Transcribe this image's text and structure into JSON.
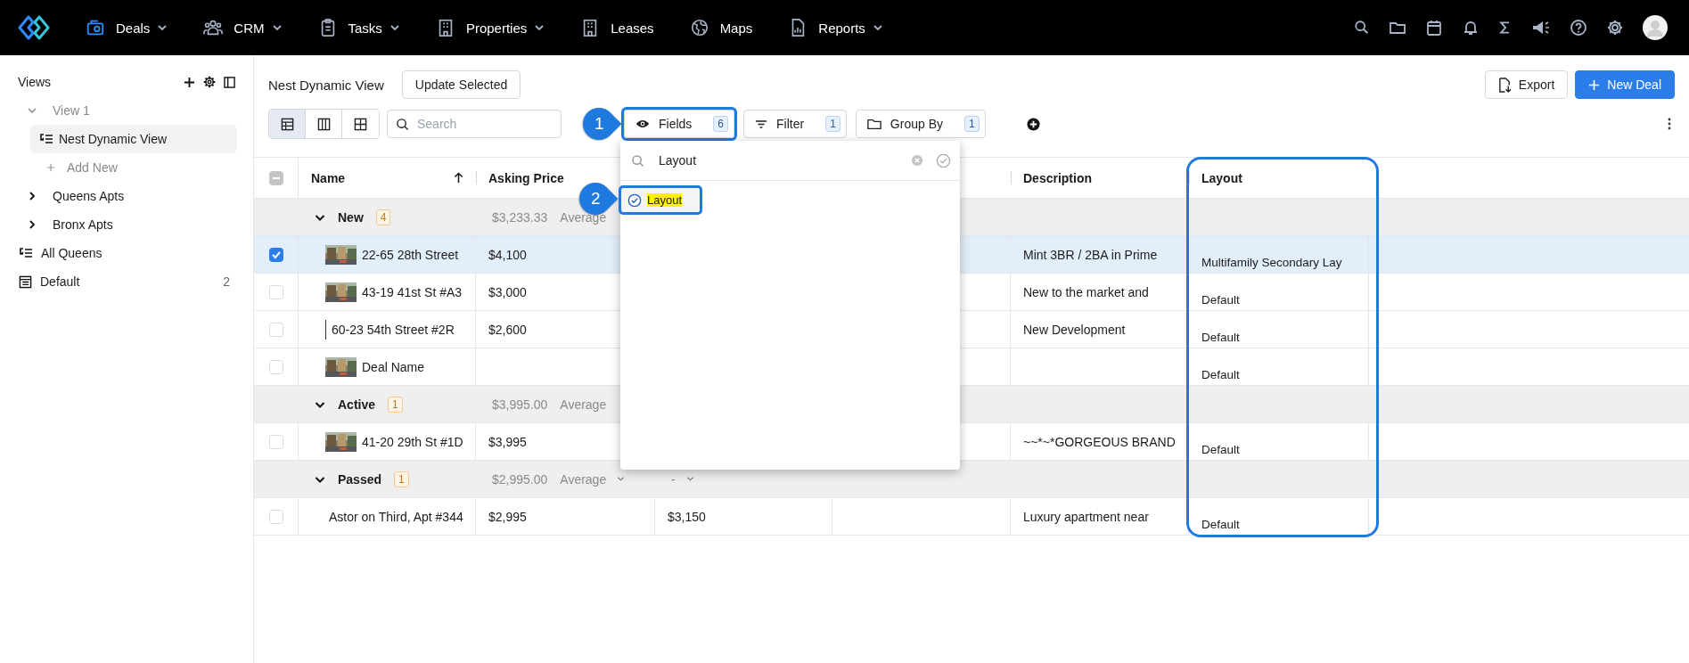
{
  "nav": {
    "items": [
      {
        "label": "Deals",
        "kind": "deals",
        "selected": true,
        "caret": true
      },
      {
        "label": "CRM",
        "kind": "crm",
        "selected": false,
        "caret": true
      },
      {
        "label": "Tasks",
        "kind": "tasks",
        "selected": false,
        "caret": true
      },
      {
        "label": "Properties",
        "kind": "building",
        "selected": false,
        "caret": true
      },
      {
        "label": "Leases",
        "kind": "building",
        "selected": false,
        "caret": false
      },
      {
        "label": "Maps",
        "kind": "globe",
        "selected": false,
        "caret": false
      },
      {
        "label": "Reports",
        "kind": "report",
        "selected": false,
        "caret": true
      }
    ]
  },
  "sidebar": {
    "title": "Views",
    "items": [
      {
        "kind": "folder",
        "label": "View 1",
        "expanded": true,
        "muted": true,
        "selected": false,
        "children": [
          {
            "kind": "view",
            "label": "Nest Dynamic View",
            "selected": true
          },
          {
            "kind": "add",
            "label": "Add New",
            "selected": false
          }
        ]
      },
      {
        "kind": "folder",
        "label": "Queens Apts",
        "expanded": false,
        "muted": false,
        "selected": false
      },
      {
        "kind": "folder",
        "label": "Bronx Apts",
        "expanded": false,
        "muted": false,
        "selected": false
      },
      {
        "kind": "view",
        "label": "All Queens",
        "selected": false
      },
      {
        "kind": "table",
        "label": "Default",
        "count": "2",
        "selected": false
      }
    ]
  },
  "page": {
    "title": "Nest Dynamic View",
    "update_button": "Update Selected",
    "export_button": "Export",
    "new_button": "New Deal"
  },
  "toolbar": {
    "view_modes": [
      {
        "kind": "table",
        "selected": true
      },
      {
        "kind": "columns",
        "selected": false
      },
      {
        "kind": "grid",
        "selected": false
      }
    ],
    "search": {
      "placeholder": "Search"
    },
    "buttons": [
      {
        "kind": "fields",
        "label": "Fields",
        "count": "6",
        "callout": "1"
      },
      {
        "kind": "filter",
        "label": "Filter",
        "count": "1"
      },
      {
        "kind": "group",
        "label": "Group By",
        "count": "1"
      }
    ]
  },
  "fields_menu": {
    "search": {
      "value": "Layout"
    },
    "items": [
      {
        "label": "Layout",
        "checked": true,
        "match": true,
        "callout": "2"
      }
    ]
  },
  "table": {
    "indeterminate": true,
    "columns": [
      {
        "label": "Name",
        "sorted": true
      },
      {
        "label": "Asking Price"
      },
      {},
      {},
      {
        "label": "Description"
      },
      {
        "label": "Layout",
        "outlined": true
      }
    ],
    "groups": [
      {
        "label": "New",
        "count": "4",
        "expanded": true,
        "summaries": [
          {
            "value": "$3,233.33",
            "label": "Average",
            "menu": false
          }
        ],
        "rows": [
          {
            "selected": true,
            "name": "22-65 28th Street",
            "asking_price": "$4,100",
            "description": "Mint 3BR / 2BA in Prime",
            "layout": "Multifamily Secondary Lay"
          },
          {
            "selected": false,
            "name": "43-19 41st St #A3",
            "asking_price": "$3,000",
            "description": "New to the market and",
            "layout": "Default"
          },
          {
            "selected": false,
            "kind": "broken",
            "name": "60-23 54th Street #2R",
            "asking_price": "$2,600",
            "description": "New Development",
            "layout": "Default"
          },
          {
            "selected": false,
            "name": "Deal Name",
            "layout": "Default"
          }
        ]
      },
      {
        "label": "Active",
        "count": "1",
        "expanded": true,
        "summaries": [
          {
            "value": "$3,995.00",
            "label": "Average",
            "menu": false
          }
        ],
        "rows": [
          {
            "selected": false,
            "name": "41-20 29th St #1D",
            "asking_price": "$3,995",
            "description": "~~*~*GORGEOUS BRAND",
            "layout": "Default"
          }
        ]
      },
      {
        "label": "Passed",
        "count": "1",
        "expanded": true,
        "summaries": [
          {
            "value": "$2,995.00",
            "label": "Average",
            "menu": true
          },
          {
            "value": "-",
            "menu": true
          }
        ],
        "rows": [
          {
            "selected": false,
            "kind": "plain",
            "name": "Astor on Third, Apt #344",
            "asking_price": "$2,995",
            "column_3": "$3,150",
            "description": "Luxury apartment near",
            "layout": "Default"
          }
        ]
      }
    ]
  }
}
